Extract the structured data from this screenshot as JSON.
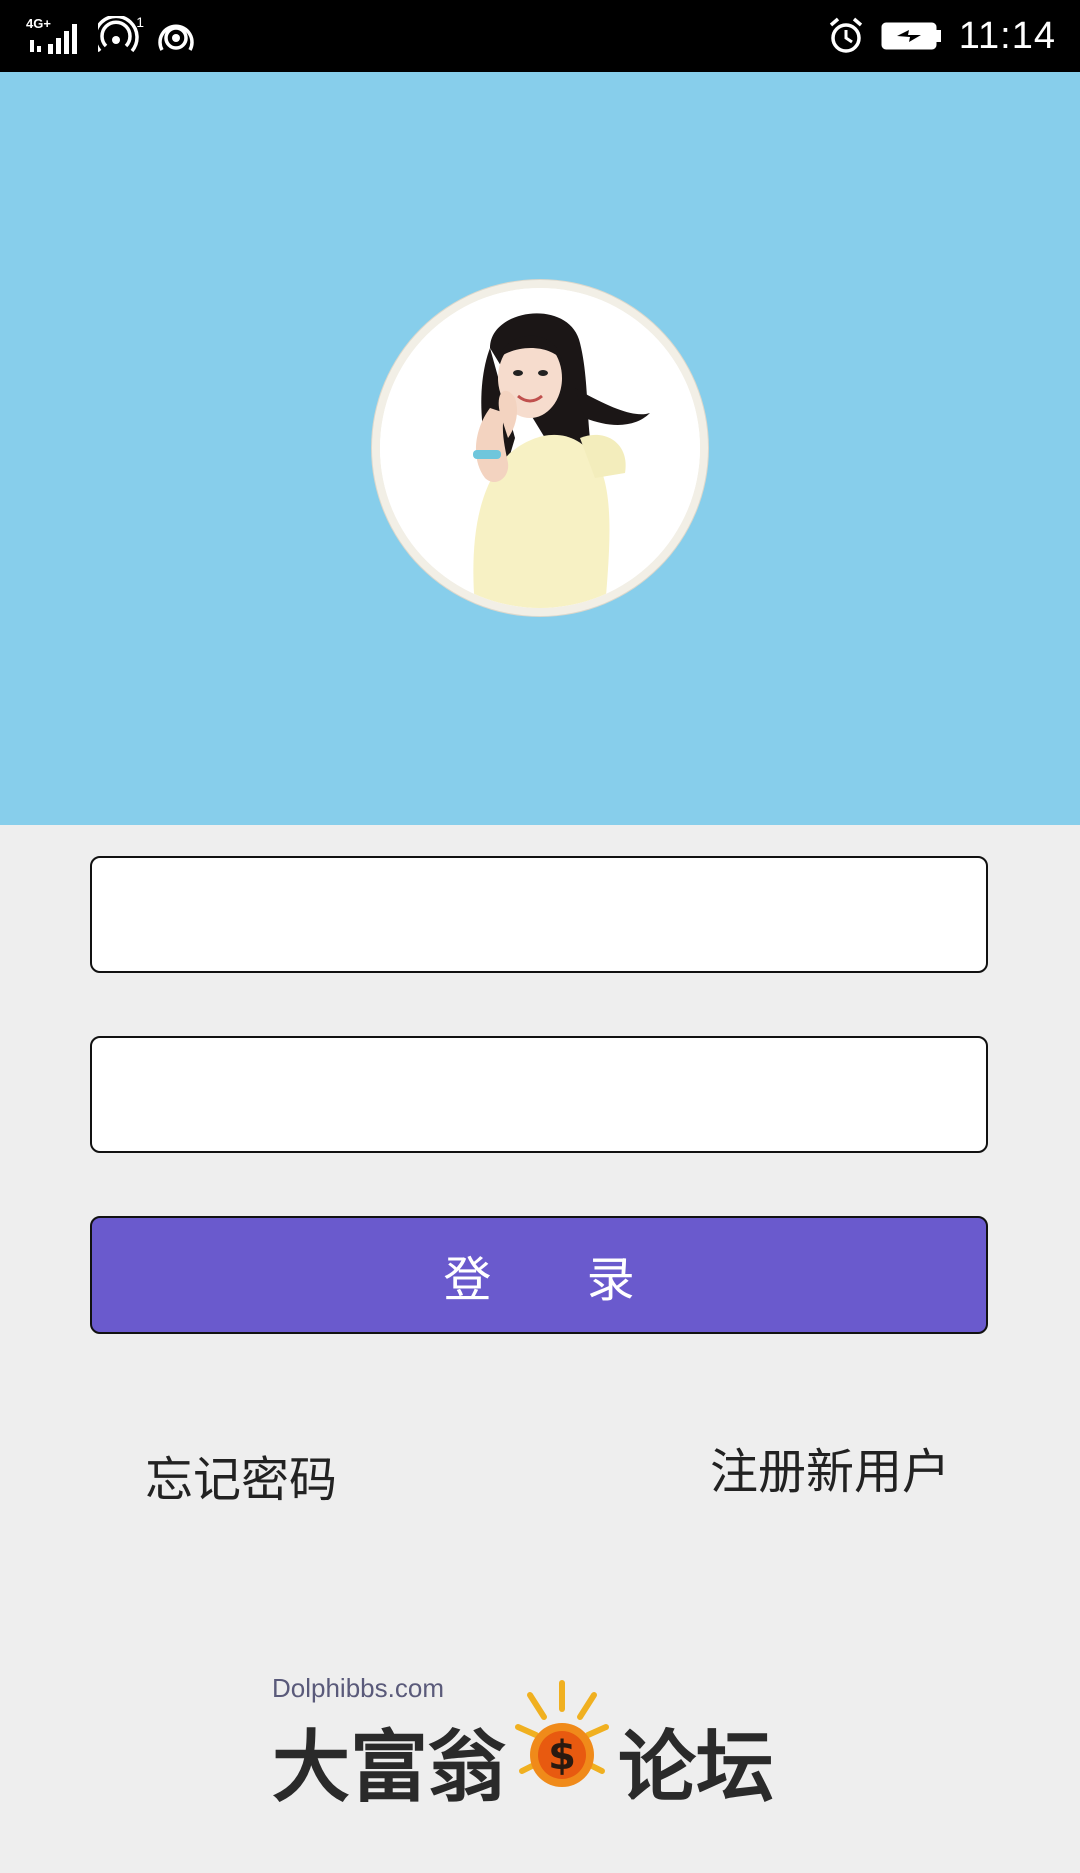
{
  "status_bar": {
    "network": "4G+",
    "sim": "1",
    "time": "11:14",
    "icons": [
      "signal-icon",
      "hotspot-icon",
      "wifi-icon",
      "alarm-icon",
      "battery-charging-icon"
    ]
  },
  "colors": {
    "hero_bg": "#87ceeb",
    "page_bg": "#eeeeee",
    "button_bg": "#6a5acd"
  },
  "login": {
    "username": {
      "value": "",
      "placeholder": ""
    },
    "password": {
      "value": "",
      "placeholder": ""
    },
    "button_label": "登 录",
    "forgot_password": "忘记密码",
    "register": "注册新用户"
  },
  "footer_logo": {
    "domain": "Dolphibbs.com",
    "name_left": "大富翁",
    "name_right": "论坛"
  }
}
